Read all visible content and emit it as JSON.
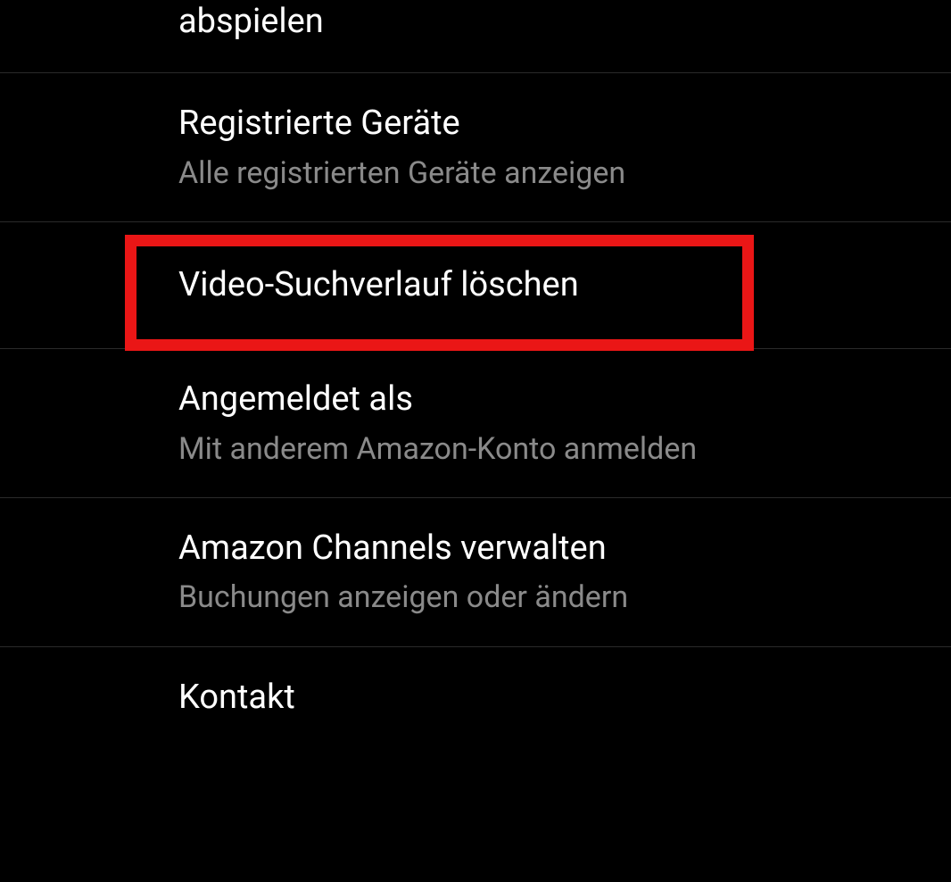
{
  "settings": {
    "items": [
      {
        "title_partial": "abspielen"
      },
      {
        "title": "Registrierte Geräte",
        "subtitle": "Alle registrierten Geräte anzeigen"
      },
      {
        "title": "Video-Suchverlauf löschen"
      },
      {
        "title": "Angemeldet als",
        "subtitle": "Mit anderem Amazon-Konto anmelden"
      },
      {
        "title": "Amazon Channels verwalten",
        "subtitle": "Buchungen anzeigen oder ändern"
      },
      {
        "title_partial": "Kontakt"
      }
    ]
  },
  "highlight": {
    "color": "#ea1616"
  }
}
